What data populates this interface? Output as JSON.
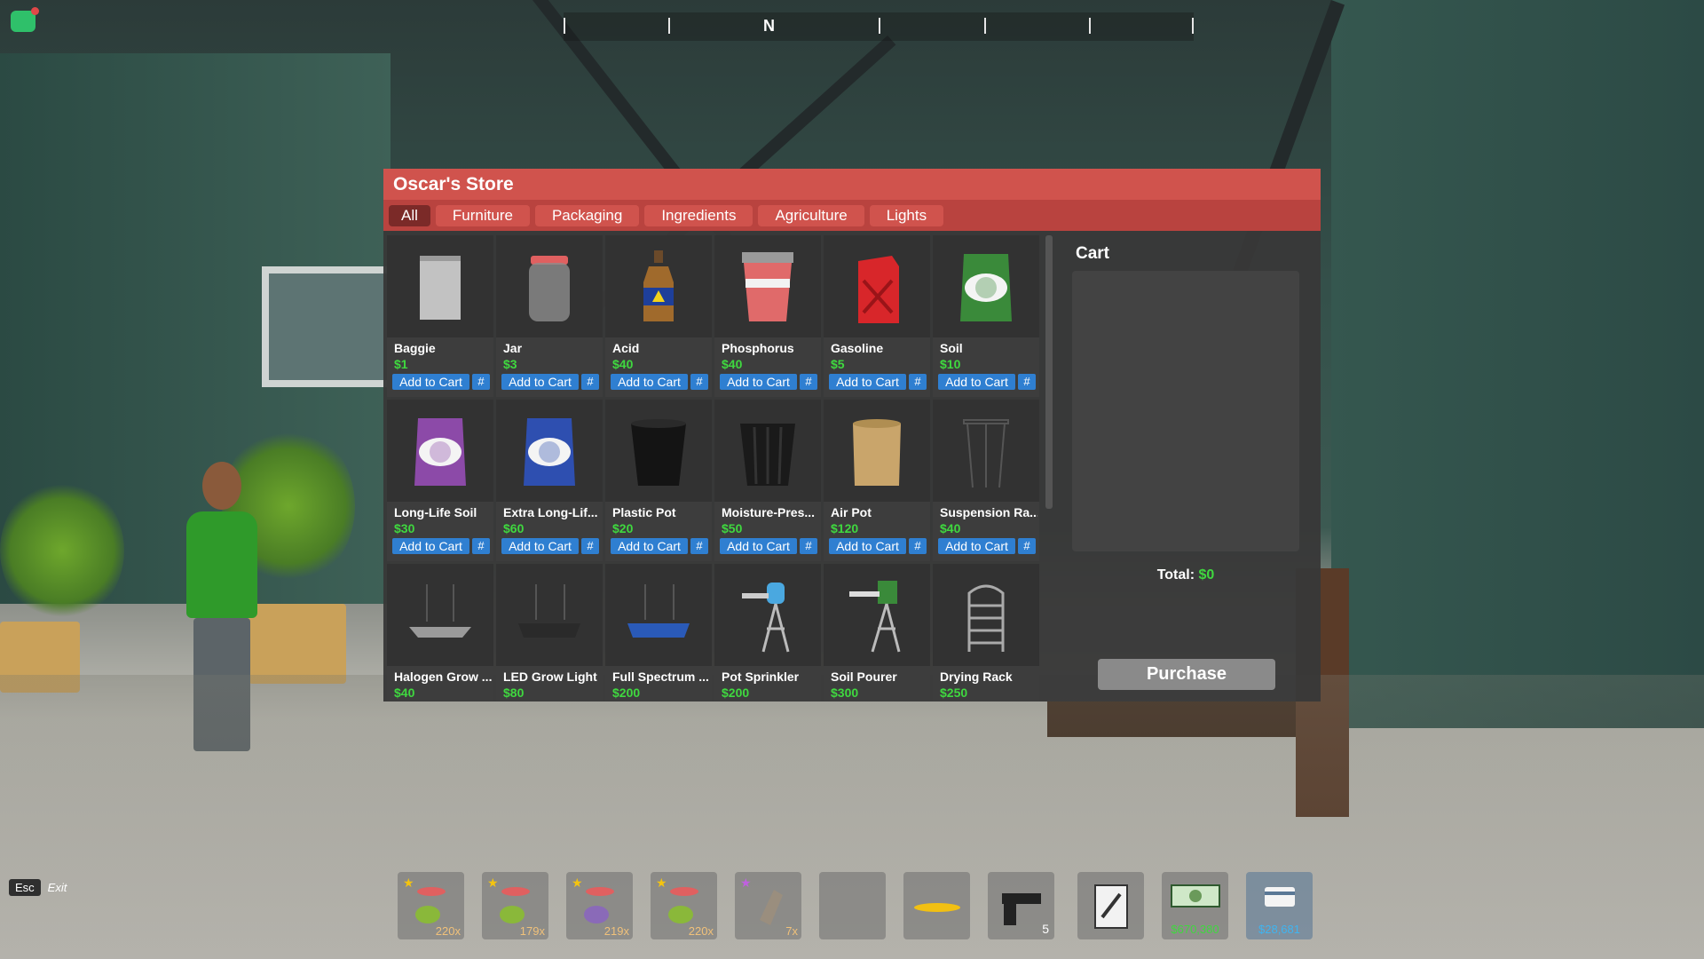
{
  "compass": {
    "heading": "N"
  },
  "store": {
    "title": "Oscar's Store",
    "tabs": [
      {
        "label": "All",
        "active": true
      },
      {
        "label": "Furniture"
      },
      {
        "label": "Packaging"
      },
      {
        "label": "Ingredients"
      },
      {
        "label": "Agriculture"
      },
      {
        "label": "Lights"
      }
    ],
    "add_label": "Add to Cart",
    "qty_label": "#",
    "items": [
      {
        "name": "Baggie",
        "price": "$1",
        "icon": "baggie-icon"
      },
      {
        "name": "Jar",
        "price": "$3",
        "icon": "jar-icon"
      },
      {
        "name": "Acid",
        "price": "$40",
        "icon": "acid-bottle-icon"
      },
      {
        "name": "Phosphorus",
        "price": "$40",
        "icon": "phosphorus-tub-icon"
      },
      {
        "name": "Gasoline",
        "price": "$5",
        "icon": "gas-can-icon"
      },
      {
        "name": "Soil",
        "price": "$10",
        "icon": "soil-bag-icon"
      },
      {
        "name": "Long-Life Soil",
        "price": "$30",
        "icon": "soil-bag-purple-icon"
      },
      {
        "name": "Extra Long-Lif...",
        "price": "$60",
        "icon": "soil-bag-blue-icon"
      },
      {
        "name": "Plastic Pot",
        "price": "$20",
        "icon": "plastic-pot-icon"
      },
      {
        "name": "Moisture-Pres...",
        "price": "$50",
        "icon": "moisture-pot-icon"
      },
      {
        "name": "Air Pot",
        "price": "$120",
        "icon": "air-pot-icon"
      },
      {
        "name": "Suspension Ra...",
        "price": "$40",
        "icon": "suspension-rack-icon"
      },
      {
        "name": "Halogen Grow ...",
        "price": "$40",
        "icon": "halogen-light-icon"
      },
      {
        "name": "LED Grow Light",
        "price": "$80",
        "icon": "led-light-icon"
      },
      {
        "name": "Full Spectrum ...",
        "price": "$200",
        "icon": "full-spectrum-light-icon"
      },
      {
        "name": "Pot Sprinkler",
        "price": "$200",
        "icon": "pot-sprinkler-icon"
      },
      {
        "name": "Soil Pourer",
        "price": "$300",
        "icon": "soil-pourer-icon"
      },
      {
        "name": "Drying Rack",
        "price": "$250",
        "icon": "drying-rack-icon"
      }
    ],
    "cart": {
      "title": "Cart",
      "total_label": "Total:",
      "total_value": "$0",
      "purchase_label": "Purchase"
    }
  },
  "hotbar": {
    "slots": [
      {
        "icon": "weed-bud-icon",
        "count": "220x",
        "star": "gold"
      },
      {
        "icon": "weed-bud-icon",
        "count": "179x",
        "star": "gold"
      },
      {
        "icon": "weed-bud-purple-icon",
        "count": "219x",
        "star": "gold"
      },
      {
        "icon": "weed-bud-icon",
        "count": "220x",
        "star": "gold"
      },
      {
        "icon": "bag-icon",
        "count": "7x",
        "star": "purple"
      },
      {
        "icon": "empty-slot",
        "count": ""
      },
      {
        "icon": "skateboard-icon",
        "count": ""
      },
      {
        "icon": "pistol-icon",
        "count": "5"
      }
    ],
    "notepad_icon": "clipboard-icon",
    "cash_amount": "$670,380",
    "card_amount": "$28,681"
  },
  "esc": {
    "key": "Esc",
    "label": "Exit"
  },
  "colors": {
    "store_header": "#d0534d",
    "tab_bar": "#b9433f",
    "add_button": "#2f7fd1",
    "price": "#3fd83f"
  }
}
